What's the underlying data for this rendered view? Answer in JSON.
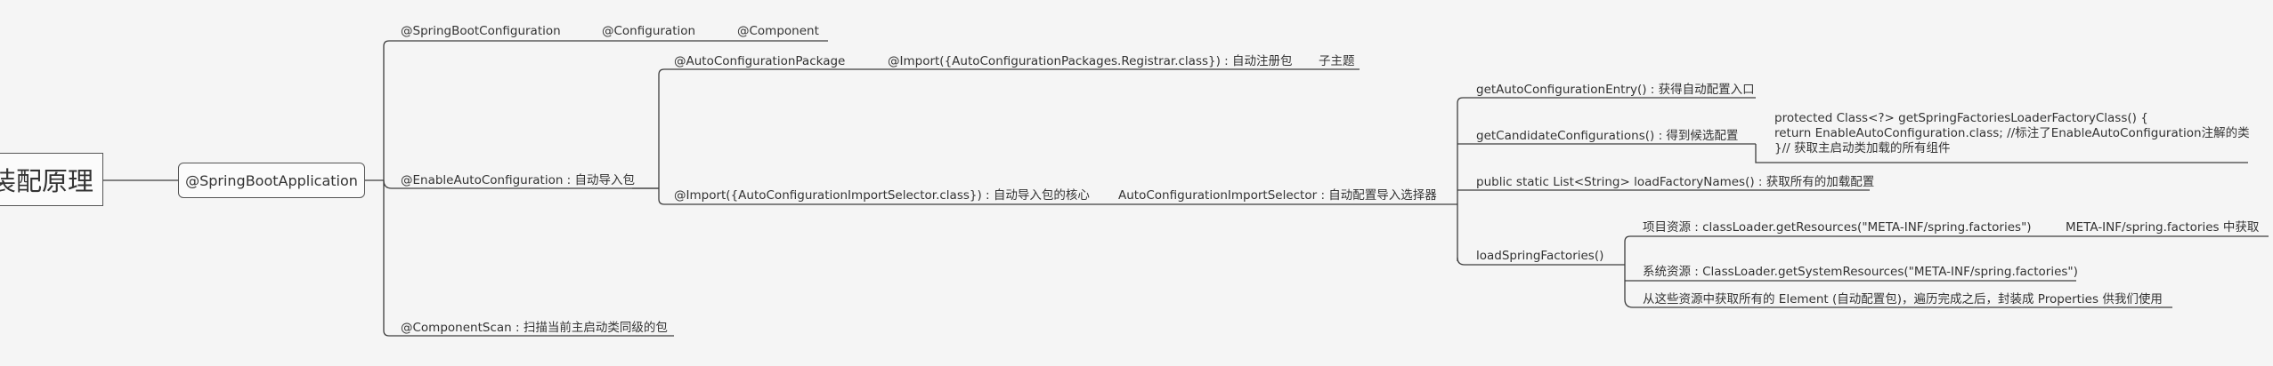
{
  "mindmap": {
    "root": "装配原理",
    "app": "@SpringBootApplication",
    "spring_boot_configuration": "@SpringBootConfiguration",
    "configuration": "@Configuration",
    "component": "@Component",
    "enable_auto_configuration": "@EnableAutoConfiguration : 自动导入包",
    "auto_configuration_package": "@AutoConfigurationPackage",
    "import_registrar": "@Import({AutoConfigurationPackages.Registrar.class}) : 自动注册包",
    "sub_topic": "子主题",
    "import_selector": "@Import({AutoConfigurationImportSelector.class}) : 自动导入包的核心",
    "selector": "AutoConfigurationImportSelector : 自动配置导入选择器",
    "get_entry": "getAutoConfigurationEntry() : 获得自动配置入口",
    "get_candidates": "getCandidateConfigurations() : 得到候选配置",
    "candidate_code": [
      "protected Class<?> getSpringFactoriesLoaderFactoryClass() {",
      "return EnableAutoConfiguration.class; //标注了EnableAutoConfiguration注解的类",
      "}// 获取主启动类加载的所有组件"
    ],
    "load_factory_names": "public static List<String> loadFactoryNames() : 获取所有的加载配置",
    "load_spring_factories": "loadSpringFactories()",
    "project_resources": "项目资源 : classLoader.getResources(\"META-INF/spring.factories\")",
    "meta_inf": "META-INF/spring.factories 中获取",
    "system_resources": "系统资源 : ClassLoader.getSystemResources(\"META-INF/spring.factories\")",
    "traverse": "从这些资源中获取所有的 Element (自动配置包)，遍历完成之后，封装成 Properties 供我们使用",
    "component_scan": "@ComponentScan : 扫描当前主启动类同级的包"
  }
}
